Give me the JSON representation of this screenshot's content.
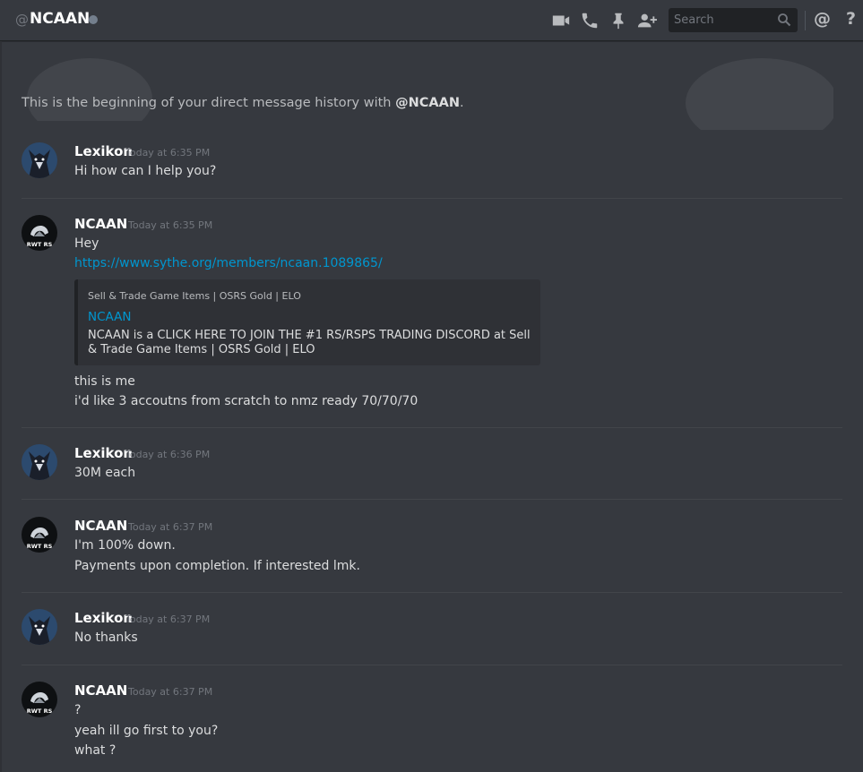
{
  "header": {
    "at_symbol": "@",
    "title": "NCAAN",
    "icons": [
      "video-icon",
      "phone-icon",
      "pin-icon",
      "add-friend-icon",
      "mention-icon",
      "help-icon"
    ],
    "search_placeholder": "Search",
    "mention_label": "@",
    "help_label": "?"
  },
  "intro": {
    "prefix": "This is the beginning of your direct message history with ",
    "handle": "@NCAAN",
    "suffix": "."
  },
  "messages": [
    {
      "author": "Lexikon",
      "time": "Today at 6:35 PM",
      "lines": [
        "Hi how can I help you?"
      ]
    },
    {
      "author": "NCAAN",
      "time": "Today at 6:35 PM",
      "lines": [
        "Hey"
      ],
      "link": "https://www.sythe.org/members/ncaan.1089865/",
      "embed": {
        "provider": "Sell & Trade Game Items | OSRS Gold | ELO",
        "title": "NCAAN",
        "description": "NCAAN is a CLICK HERE TO JOIN THE #1 RS/RSPS TRADING DISCORD at Sell & Trade Game Items | OSRS Gold | ELO"
      },
      "after_lines": [
        "this is me",
        "i'd like 3 accoutns from scratch to nmz ready 70/70/70"
      ]
    },
    {
      "author": "Lexikon",
      "time": "Today at 6:36 PM",
      "lines": [
        "30M each"
      ]
    },
    {
      "author": "NCAAN",
      "time": "Today at 6:37 PM",
      "lines": [
        "I'm 100% down.",
        "Payments upon completion. If interested lmk."
      ]
    },
    {
      "author": "Lexikon",
      "time": "Today at 6:37 PM",
      "lines": [
        "No thanks"
      ]
    },
    {
      "author": "NCAAN",
      "time": "Today at 6:37 PM",
      "lines": [
        "?",
        "yeah ill go first to you?",
        "what ?"
      ]
    }
  ],
  "avatars": {
    "ncaan_badge": "RWT RS"
  },
  "colors": {
    "background": "#36393f",
    "link": "#0096cf",
    "username": "#ffffff",
    "timestamp": "#72767d",
    "text": "#dcddde"
  }
}
